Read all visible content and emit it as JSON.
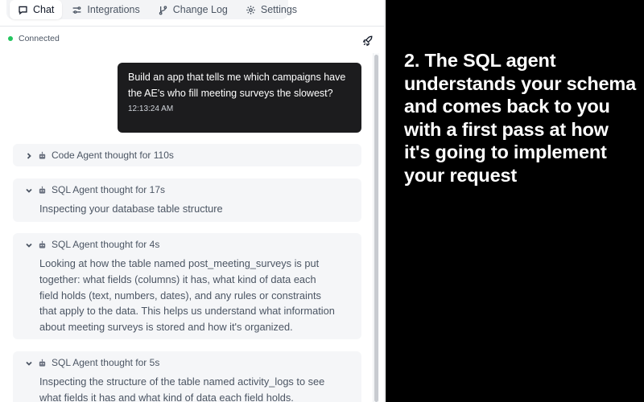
{
  "tabs": [
    {
      "label": "Chat",
      "icon": "chat-icon",
      "active": true
    },
    {
      "label": "Integrations",
      "icon": "sliders-icon",
      "active": false
    },
    {
      "label": "Change Log",
      "icon": "git-branch-icon",
      "active": false
    },
    {
      "label": "Settings",
      "icon": "gear-icon",
      "active": false
    }
  ],
  "status": {
    "label": "Connected",
    "color": "#22c55e"
  },
  "user_message": {
    "text": "Build an app that tells me which campaigns have the AE's who fill meeting surveys the slowest?",
    "time": "12:13:24 AM"
  },
  "agent_steps": [
    {
      "title": "Code Agent thought for 110s",
      "expanded": false,
      "body": ""
    },
    {
      "title": "SQL Agent thought for 17s",
      "expanded": true,
      "body": "Inspecting your database table structure"
    },
    {
      "title": "SQL Agent thought for 4s",
      "expanded": true,
      "body": "Looking at how the table named post_meeting_surveys is put together: what fields (columns) it has, what kind of data each field holds (text, numbers, dates), and any rules or constraints that apply to the data. This helps us understand what information about meeting surveys is stored and how it's organized."
    },
    {
      "title": "SQL Agent thought for 5s",
      "expanded": true,
      "body": "Inspecting the structure of the table named activity_logs to see what fields it has and what kind of data each field holds."
    }
  ],
  "caption": "2. The SQL agent understands your schema and comes back to you with a first pass at how it's going to implement your request",
  "colors": {
    "panel_bg": "#000000",
    "user_bubble": "#1c1c1e",
    "card_bg": "#f5f6f8"
  }
}
